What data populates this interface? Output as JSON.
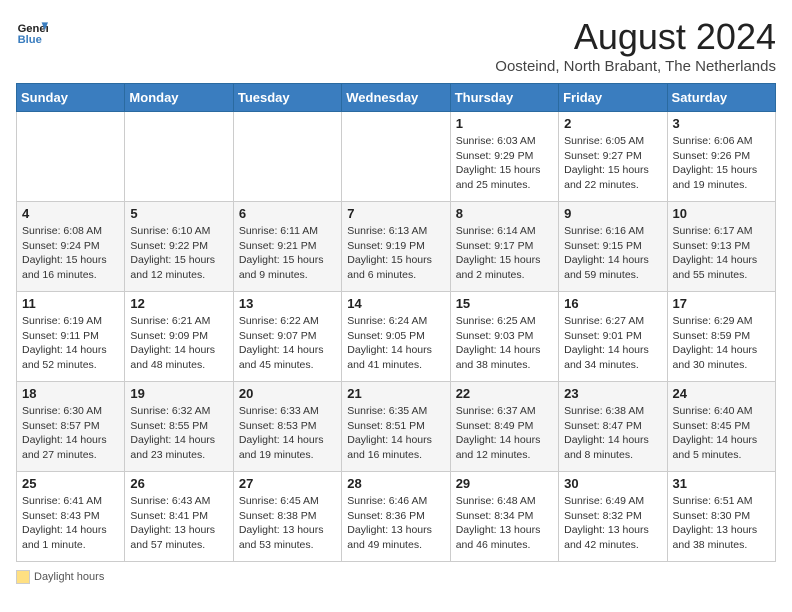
{
  "header": {
    "logo_line1": "General",
    "logo_line2": "Blue",
    "month": "August 2024",
    "location": "Oosteind, North Brabant, The Netherlands"
  },
  "legend": {
    "label": "Daylight hours"
  },
  "days_of_week": [
    "Sunday",
    "Monday",
    "Tuesday",
    "Wednesday",
    "Thursday",
    "Friday",
    "Saturday"
  ],
  "weeks": [
    [
      {
        "num": "",
        "info": ""
      },
      {
        "num": "",
        "info": ""
      },
      {
        "num": "",
        "info": ""
      },
      {
        "num": "",
        "info": ""
      },
      {
        "num": "1",
        "info": "Sunrise: 6:03 AM\nSunset: 9:29 PM\nDaylight: 15 hours\nand 25 minutes."
      },
      {
        "num": "2",
        "info": "Sunrise: 6:05 AM\nSunset: 9:27 PM\nDaylight: 15 hours\nand 22 minutes."
      },
      {
        "num": "3",
        "info": "Sunrise: 6:06 AM\nSunset: 9:26 PM\nDaylight: 15 hours\nand 19 minutes."
      }
    ],
    [
      {
        "num": "4",
        "info": "Sunrise: 6:08 AM\nSunset: 9:24 PM\nDaylight: 15 hours\nand 16 minutes."
      },
      {
        "num": "5",
        "info": "Sunrise: 6:10 AM\nSunset: 9:22 PM\nDaylight: 15 hours\nand 12 minutes."
      },
      {
        "num": "6",
        "info": "Sunrise: 6:11 AM\nSunset: 9:21 PM\nDaylight: 15 hours\nand 9 minutes."
      },
      {
        "num": "7",
        "info": "Sunrise: 6:13 AM\nSunset: 9:19 PM\nDaylight: 15 hours\nand 6 minutes."
      },
      {
        "num": "8",
        "info": "Sunrise: 6:14 AM\nSunset: 9:17 PM\nDaylight: 15 hours\nand 2 minutes."
      },
      {
        "num": "9",
        "info": "Sunrise: 6:16 AM\nSunset: 9:15 PM\nDaylight: 14 hours\nand 59 minutes."
      },
      {
        "num": "10",
        "info": "Sunrise: 6:17 AM\nSunset: 9:13 PM\nDaylight: 14 hours\nand 55 minutes."
      }
    ],
    [
      {
        "num": "11",
        "info": "Sunrise: 6:19 AM\nSunset: 9:11 PM\nDaylight: 14 hours\nand 52 minutes."
      },
      {
        "num": "12",
        "info": "Sunrise: 6:21 AM\nSunset: 9:09 PM\nDaylight: 14 hours\nand 48 minutes."
      },
      {
        "num": "13",
        "info": "Sunrise: 6:22 AM\nSunset: 9:07 PM\nDaylight: 14 hours\nand 45 minutes."
      },
      {
        "num": "14",
        "info": "Sunrise: 6:24 AM\nSunset: 9:05 PM\nDaylight: 14 hours\nand 41 minutes."
      },
      {
        "num": "15",
        "info": "Sunrise: 6:25 AM\nSunset: 9:03 PM\nDaylight: 14 hours\nand 38 minutes."
      },
      {
        "num": "16",
        "info": "Sunrise: 6:27 AM\nSunset: 9:01 PM\nDaylight: 14 hours\nand 34 minutes."
      },
      {
        "num": "17",
        "info": "Sunrise: 6:29 AM\nSunset: 8:59 PM\nDaylight: 14 hours\nand 30 minutes."
      }
    ],
    [
      {
        "num": "18",
        "info": "Sunrise: 6:30 AM\nSunset: 8:57 PM\nDaylight: 14 hours\nand 27 minutes."
      },
      {
        "num": "19",
        "info": "Sunrise: 6:32 AM\nSunset: 8:55 PM\nDaylight: 14 hours\nand 23 minutes."
      },
      {
        "num": "20",
        "info": "Sunrise: 6:33 AM\nSunset: 8:53 PM\nDaylight: 14 hours\nand 19 minutes."
      },
      {
        "num": "21",
        "info": "Sunrise: 6:35 AM\nSunset: 8:51 PM\nDaylight: 14 hours\nand 16 minutes."
      },
      {
        "num": "22",
        "info": "Sunrise: 6:37 AM\nSunset: 8:49 PM\nDaylight: 14 hours\nand 12 minutes."
      },
      {
        "num": "23",
        "info": "Sunrise: 6:38 AM\nSunset: 8:47 PM\nDaylight: 14 hours\nand 8 minutes."
      },
      {
        "num": "24",
        "info": "Sunrise: 6:40 AM\nSunset: 8:45 PM\nDaylight: 14 hours\nand 5 minutes."
      }
    ],
    [
      {
        "num": "25",
        "info": "Sunrise: 6:41 AM\nSunset: 8:43 PM\nDaylight: 14 hours\nand 1 minute."
      },
      {
        "num": "26",
        "info": "Sunrise: 6:43 AM\nSunset: 8:41 PM\nDaylight: 13 hours\nand 57 minutes."
      },
      {
        "num": "27",
        "info": "Sunrise: 6:45 AM\nSunset: 8:38 PM\nDaylight: 13 hours\nand 53 minutes."
      },
      {
        "num": "28",
        "info": "Sunrise: 6:46 AM\nSunset: 8:36 PM\nDaylight: 13 hours\nand 49 minutes."
      },
      {
        "num": "29",
        "info": "Sunrise: 6:48 AM\nSunset: 8:34 PM\nDaylight: 13 hours\nand 46 minutes."
      },
      {
        "num": "30",
        "info": "Sunrise: 6:49 AM\nSunset: 8:32 PM\nDaylight: 13 hours\nand 42 minutes."
      },
      {
        "num": "31",
        "info": "Sunrise: 6:51 AM\nSunset: 8:30 PM\nDaylight: 13 hours\nand 38 minutes."
      }
    ]
  ]
}
